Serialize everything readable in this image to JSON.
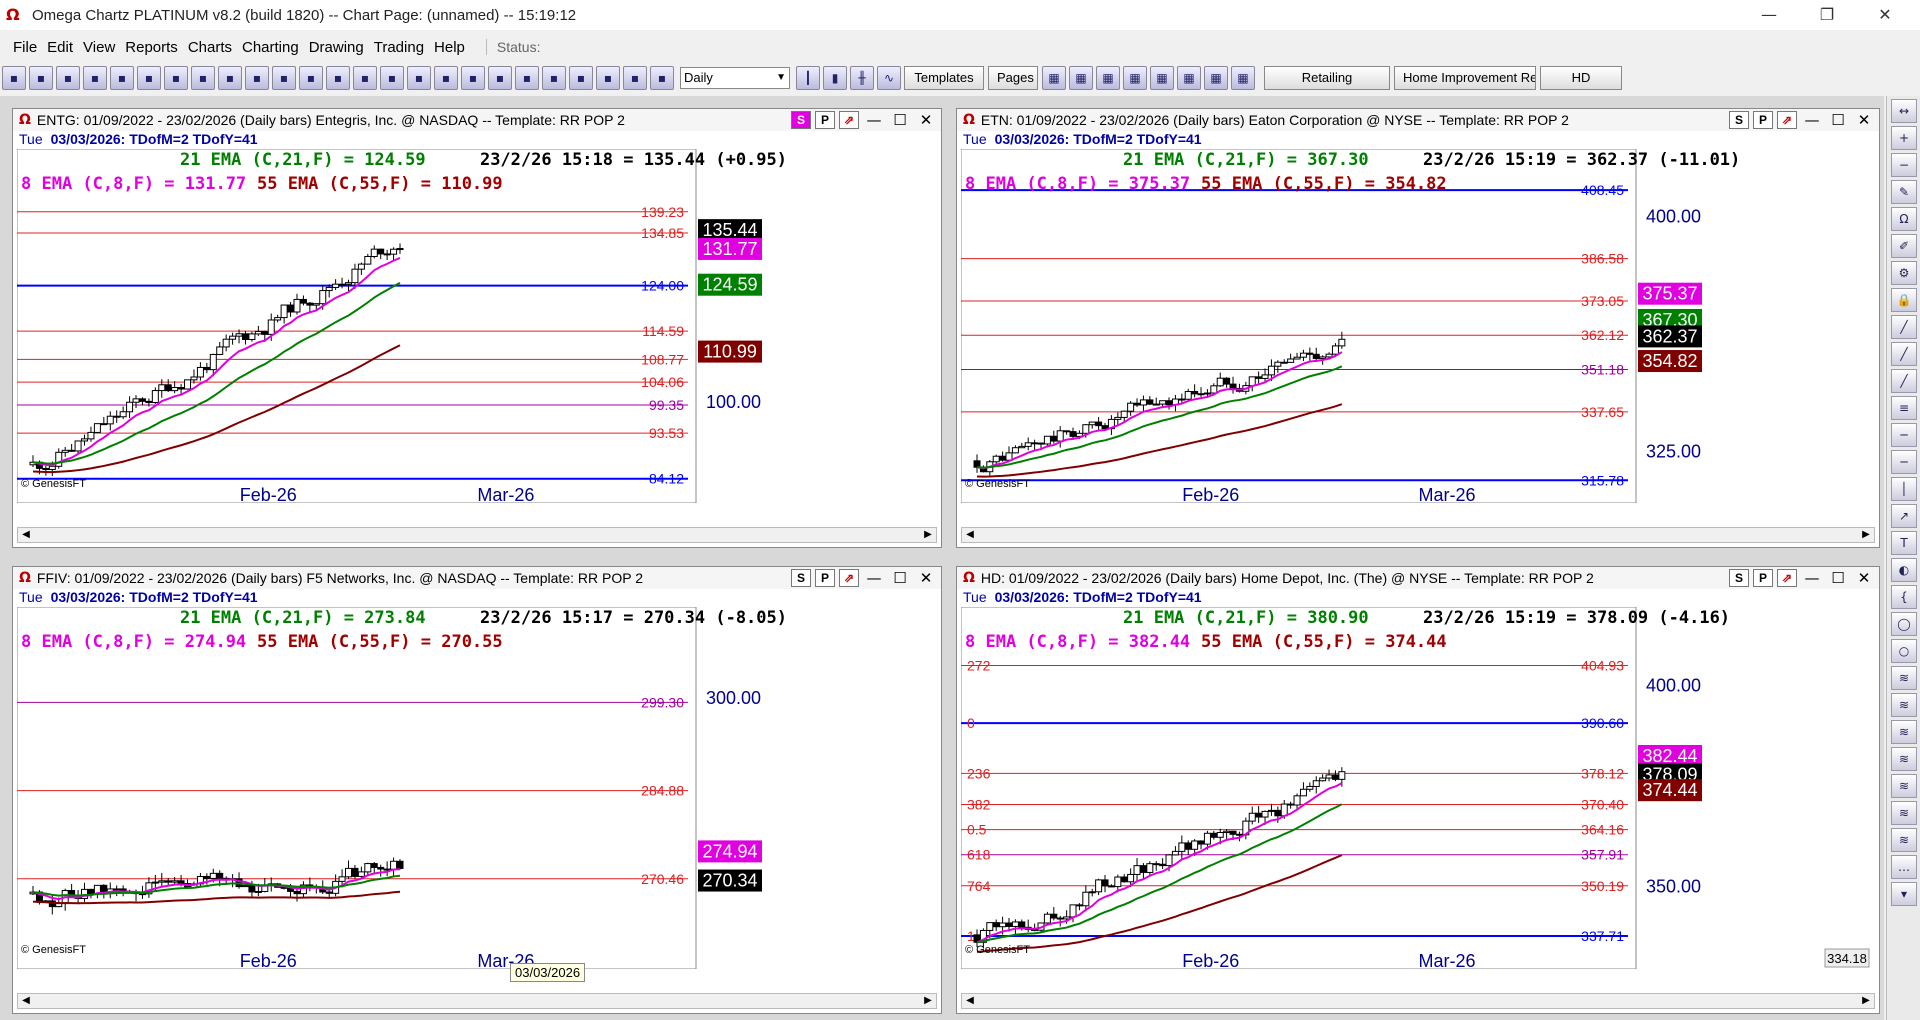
{
  "window": {
    "title": "Omega Chartz PLATINUM v8.2 (build 1820)  --  Chart Page: (unnamed) -- 15:19:12"
  },
  "menu": {
    "items": [
      "File",
      "Edit",
      "View",
      "Reports",
      "Charts",
      "Charting",
      "Drawing",
      "Trading",
      "Help"
    ],
    "status_label": "Status:"
  },
  "toolbar": {
    "period": "Daily",
    "templates_label": "Templates",
    "pages_label": "Pages",
    "tabs": [
      "Retailing",
      "Home Improvement Reta",
      "HD"
    ]
  },
  "tooltip": "03/03/2026",
  "charts": [
    {
      "id": "entg",
      "title": "ENTG: 01/09/2022 - 23/02/2026 (Daily bars)  Entegris, Inc. @ NASDAQ  --  Template: RR POP 2",
      "date_line": {
        "day": "Tue",
        "date": "03/03/2026: TDofM=2  TDofY=41"
      },
      "s_active": true,
      "ema_line": {
        "ema21": "21 EMA (C,21,F) = 124.59",
        "quote": "23/2/26 15:18 = 135.44 (+0.95)"
      },
      "ema_line2": {
        "ema8": "8 EMA (C,8,F) = 131.77",
        "ema55": "55 EMA (C,55,F) = 110.99"
      },
      "levels": [
        {
          "v": 139.23,
          "c": "#e02020"
        },
        {
          "v": 134.85,
          "c": "#e02020"
        },
        {
          "v": 124.0,
          "c": "#0000ff",
          "w": 2
        },
        {
          "v": 114.59,
          "c": "#e02020"
        },
        {
          "v": 108.77,
          "c": "#e02020"
        },
        {
          "v": 104.06,
          "c": "#e02020"
        },
        {
          "v": 99.35,
          "c": "#a000a0"
        },
        {
          "v": 93.53,
          "c": "#e02020"
        },
        {
          "v": 84.12,
          "c": "#0000ff",
          "w": 2
        }
      ],
      "axis": [
        {
          "v": 100,
          "t": "100.00"
        }
      ],
      "price_tags": [
        {
          "t": "135.44",
          "v": 135.44,
          "bg": "#000"
        },
        {
          "t": "131.77",
          "v": 131.77,
          "bg": "#e000e0"
        },
        {
          "t": "124.59",
          "v": 124.59,
          "bg": "#008000"
        },
        {
          "t": "110.99",
          "v": 110.99,
          "bg": "#800000"
        }
      ],
      "xlabels": [
        "Feb-26",
        "Mar-26"
      ],
      "credit": "© GenesisFT"
    },
    {
      "id": "etn",
      "title": "ETN: 01/09/2022 - 23/02/2026 (Daily bars)  Eaton Corporation @ NYSE  --  Template: RR POP 2",
      "date_line": {
        "day": "Tue",
        "date": "03/03/2026: TDofM=2  TDofY=41"
      },
      "s_active": false,
      "ema_line": {
        "ema21": "21 EMA (C,21,F) = 367.30",
        "quote": "23/2/26 15:19 = 362.37 (-11.01)"
      },
      "ema_line2": {
        "ema8": "8 EMA (C,8,F) = 375.37",
        "ema55": "55 EMA (C,55,F) = 354.82"
      },
      "levels": [
        {
          "v": 408.45,
          "c": "#0000ff",
          "w": 2
        },
        {
          "v": 386.58,
          "c": "#e02020"
        },
        {
          "v": 373.05,
          "c": "#e02020"
        },
        {
          "v": 362.12,
          "c": "#e02020"
        },
        {
          "v": 351.18,
          "c": "#a000a0"
        },
        {
          "v": 337.65,
          "c": "#e02020"
        },
        {
          "v": 315.78,
          "c": "#0000ff",
          "w": 2
        }
      ],
      "axis": [
        {
          "v": 400,
          "t": "400.00"
        },
        {
          "v": 325,
          "t": "325.00"
        }
      ],
      "price_tags": [
        {
          "t": "375.37",
          "v": 375.37,
          "bg": "#e000e0"
        },
        {
          "t": "367.30",
          "v": 367.3,
          "bg": "#008000"
        },
        {
          "t": "362.37",
          "v": 362.37,
          "bg": "#000"
        },
        {
          "t": "354.82",
          "v": 354.82,
          "bg": "#800000"
        }
      ],
      "xlabels": [
        "Feb-26",
        "Mar-26"
      ],
      "credit": "© GenesisFT"
    },
    {
      "id": "ffiv",
      "title": "FFIV: 01/09/2022 - 23/02/2026 (Daily bars)  F5 Networks, Inc. @ NASDAQ  --  Template: RR POP 2",
      "date_line": {
        "day": "Tue",
        "date": "03/03/2026: TDofM=2  TDofY=41"
      },
      "s_active": false,
      "ema_line": {
        "ema21": "21 EMA (C,21,F) = 273.84",
        "quote": "23/2/26 15:17 = 270.34 (-8.05)"
      },
      "ema_line2": {
        "ema8": "8 EMA (C,8,F) = 274.94",
        "ema55": "55 EMA (C,55,F) = 270.55"
      },
      "levels": [
        {
          "v": 299.3,
          "c": "#a000a0"
        },
        {
          "v": 284.88,
          "c": "#e02020"
        },
        {
          "v": 270.46,
          "c": "#e02020"
        }
      ],
      "axis": [
        {
          "v": 300,
          "t": "300.00"
        }
      ],
      "price_tags": [
        {
          "t": "274.94",
          "v": 274.94,
          "bg": "#e000e0"
        },
        {
          "t": "270.34",
          "v": 270.34,
          "bg": "#000"
        }
      ],
      "xlabels": [
        "Feb-26",
        "Mar-26"
      ],
      "credit": "© GenesisFT"
    },
    {
      "id": "hd",
      "title": "HD: 01/09/2022 - 23/02/2026 (Daily bars)  Home Depot, Inc. (The) @ NYSE  --  Template: RR POP 2",
      "date_line": {
        "day": "Tue",
        "date": "03/03/2026: TDofM=2  TDofY=41"
      },
      "s_active": false,
      "ema_line": {
        "ema21": "21 EMA (C,21,F) = 380.90",
        "quote": "23/2/26 15:19 = 378.09 (-4.16)"
      },
      "ema_line2": {
        "ema8": "8 EMA (C,8,F) = 382.44",
        "ema55": "55 EMA (C,55,F) = 374.44"
      },
      "levels": [
        {
          "v": 404.93,
          "c": "#e02020",
          "t": "404.93"
        },
        {
          "v": 390.6,
          "c": "#0000ff",
          "w": 2
        },
        {
          "v": 378.12,
          "c": "#e02020"
        },
        {
          "v": 370.4,
          "c": "#e02020"
        },
        {
          "v": 364.16,
          "c": "#e02020"
        },
        {
          "v": 357.91,
          "c": "#a000a0"
        },
        {
          "v": 350.19,
          "c": "#e02020"
        },
        {
          "v": 337.71,
          "c": "#0000ff",
          "w": 2
        }
      ],
      "fib_labels": [
        "272",
        "0",
        "236",
        "382",
        "0.5",
        "618",
        "764",
        "1"
      ],
      "axis": [
        {
          "v": 400,
          "t": "400.00"
        },
        {
          "v": 350,
          "t": "350.00"
        }
      ],
      "price_tags": [
        {
          "t": "382.44",
          "v": 382.44,
          "bg": "#e000e0"
        },
        {
          "t": "378.09",
          "v": 378.09,
          "bg": "#000"
        },
        {
          "t": "374.44",
          "v": 374.44,
          "bg": "#800000"
        }
      ],
      "extra_tag": "334.18",
      "xlabels": [
        "Feb-26",
        "Mar-26"
      ],
      "credit": "© GenesisFT"
    }
  ]
}
